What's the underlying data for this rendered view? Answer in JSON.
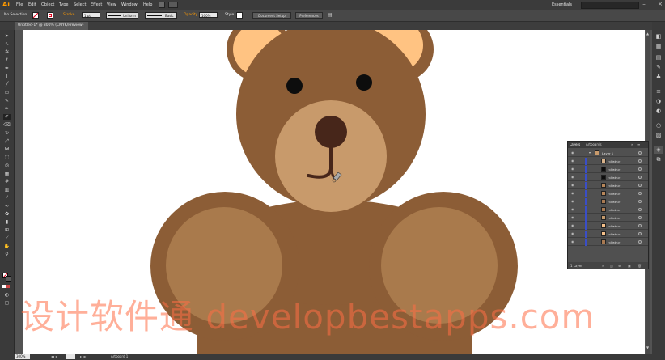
{
  "app": {
    "logo": "Ai"
  },
  "menu": [
    "File",
    "Edit",
    "Object",
    "Type",
    "Select",
    "Effect",
    "View",
    "Window",
    "Help"
  ],
  "workspace": "Essentials",
  "control_bar": {
    "selection": "No Selection",
    "stroke_label": "Stroke",
    "stroke_weight": "1 pt",
    "profile_uniform": "Uniform",
    "brush_basic": "Basic",
    "opacity_label": "Opacity",
    "opacity_value": "100%",
    "style_label": "Style",
    "document_setup": "Document Setup",
    "preferences": "Preferences"
  },
  "document_tab": "Untitled-1* @ 300% (CMYK/Preview)",
  "status_bar": {
    "zoom": "300%",
    "artboard_label": "Artboard 1"
  },
  "layers_panel": {
    "tabs": [
      "Layers",
      "Artboards"
    ],
    "layer_name": "Layer 1",
    "sublayers": [
      {
        "name": "<Path>",
        "color": "#d8b28a"
      },
      {
        "name": "<Path>",
        "color": "#0d0d0d"
      },
      {
        "name": "<Path>",
        "color": "#0d0d0d"
      },
      {
        "name": "<Path>",
        "color": "#b8875a"
      },
      {
        "name": "<Path>",
        "color": "#b8875a"
      },
      {
        "name": "<Path>",
        "color": "#a97a52"
      },
      {
        "name": "<Path>",
        "color": "#a97a52"
      },
      {
        "name": "<Path>",
        "color": "#c59a6c"
      },
      {
        "name": "<Path>",
        "color": "#f5c08a"
      },
      {
        "name": "<Path>",
        "color": "#f5c08a"
      },
      {
        "name": "<Path>",
        "color": "#a97a52"
      }
    ],
    "footer": "1 Layer"
  },
  "watermark": "设计软件通 developbestapps.com",
  "colors": {
    "bear_dark": "#8c5d36",
    "bear_light": "#c89a6b",
    "belly": "#a97a4c",
    "ear_inner": "#ffc382",
    "nose": "#47261a",
    "accent": "#ff9a00"
  }
}
